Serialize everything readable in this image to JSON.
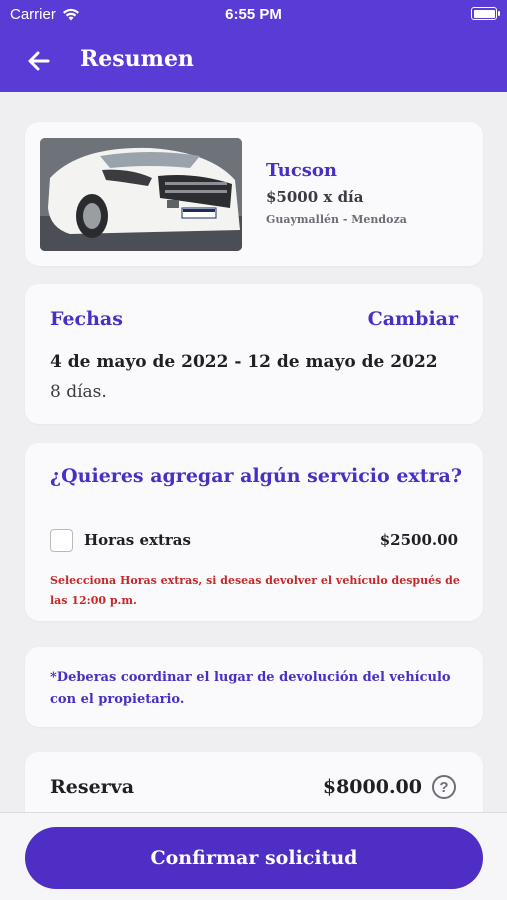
{
  "status_bar": {
    "carrier": "Carrier",
    "time": "6:55 PM",
    "wifi_icon": "wifi-icon",
    "battery_icon": "battery-icon",
    "battery_level": 1.0
  },
  "header": {
    "title": "Resumen",
    "back_icon": "arrow-left-icon",
    "color": "#5b3bd6"
  },
  "vehicle": {
    "name": "Tucson",
    "price": "$5000 x día",
    "location": "Guaymallén - Mendoza",
    "photo": "white-suv-photo"
  },
  "dates": {
    "title": "Fechas",
    "change_label": "Cambiar",
    "range": "4 de mayo de 2022 - 12 de mayo de 2022",
    "days": "8 días."
  },
  "extras": {
    "title": "¿Quieres agregar algún servicio extra?",
    "item_label": "Horas extras",
    "item_price": "$2500.00",
    "item_checked": false,
    "note": "Selecciona Horas extras, si deseas devolver el vehículo después de las 12:00 p.m."
  },
  "notice": {
    "text": "*Deberas coordinar el lugar de devolución del vehículo con el propietario."
  },
  "reserve": {
    "label": "Reserva",
    "amount": "$8000.00",
    "help_icon": "question-circle-icon"
  },
  "footer": {
    "confirm_label": "Confirmar solicitud",
    "accent": "#4f2ec5"
  }
}
